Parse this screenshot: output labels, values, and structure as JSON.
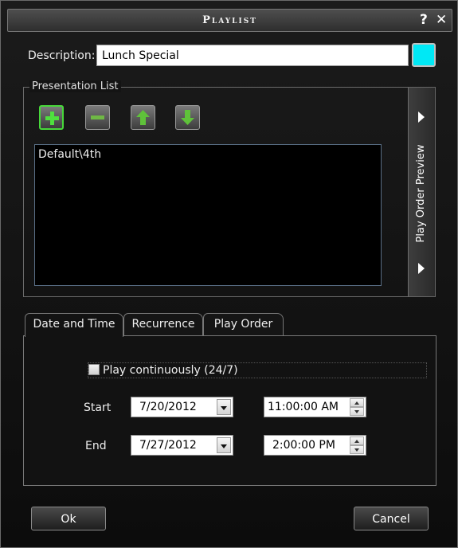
{
  "window": {
    "title": "Playlist",
    "help_glyph": "?",
    "close_glyph": "✕"
  },
  "description": {
    "label": "Description:",
    "value": "Lunch Special",
    "color": "#00e8f5"
  },
  "presentation_list": {
    "legend": "Presentation List",
    "toolbar": [
      "add-icon",
      "remove-icon",
      "move-up-icon",
      "move-down-icon"
    ],
    "items": [
      "Default\\4th"
    ]
  },
  "preview": {
    "label": "Play Order Preview"
  },
  "tabs": [
    {
      "label": "Date and Time",
      "active": true
    },
    {
      "label": "Recurrence",
      "active": false
    },
    {
      "label": "Play Order",
      "active": false
    }
  ],
  "date_time": {
    "play_continuously_label": "Play continuously (24/7)",
    "play_continuously_checked": false,
    "start_label": "Start",
    "start_date": "7/20/2012",
    "start_time": "11:00:00 AM",
    "end_label": "End",
    "end_date": "7/27/2012",
    "end_time": "2:00:00 PM"
  },
  "buttons": {
    "ok": "Ok",
    "cancel": "Cancel"
  }
}
